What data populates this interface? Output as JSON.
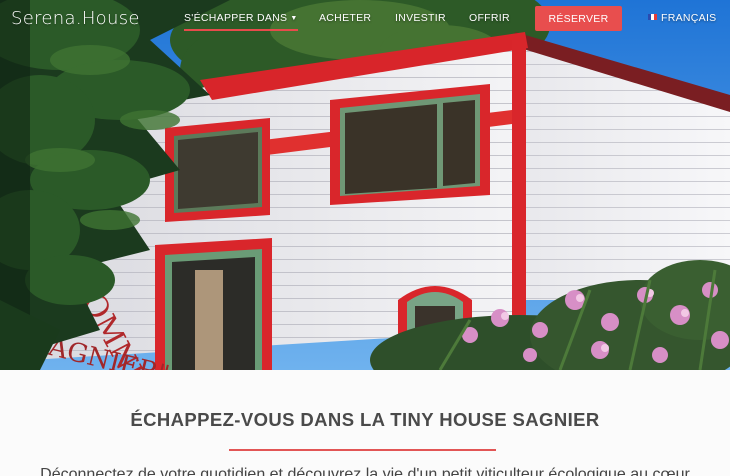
{
  "header": {
    "logo": "Serena.House",
    "nav": {
      "escape": "S'ÉCHAPPER DANS",
      "buy": "ACHETER",
      "invest": "INVESTIR",
      "offer": "OFFRIR",
      "reserve": "RÉSERVER",
      "language": "FRANÇAIS"
    }
  },
  "hero": {
    "sign_text_1": "OMNIS",
    "sign_text_2": "SAGNIER\""
  },
  "main": {
    "title": "ÉCHAPPEZ-VOUS DANS LA TINY HOUSE SAGNIER",
    "intro": "Déconnectez de votre quotidien et découvrez la vie d'un petit viticulteur écologique au cœur"
  },
  "colors": {
    "accent": "#e84e4e",
    "trim_red": "#e02a2a",
    "sky": "#2f86e0"
  }
}
